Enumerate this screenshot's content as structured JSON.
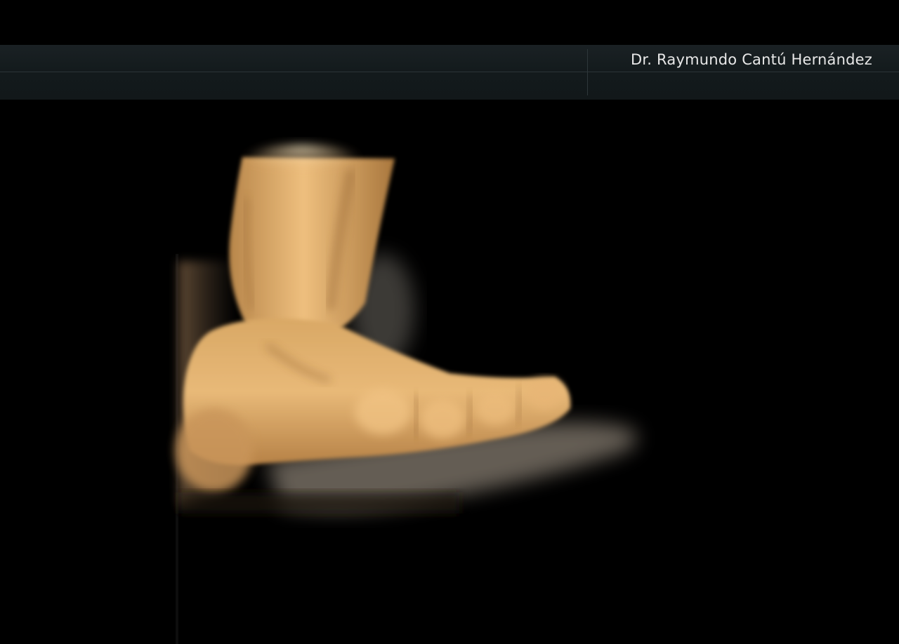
{
  "header": {
    "doctor_name": "Dr. Raymundo Cantú Hernández"
  },
  "colors": {
    "background": "#000000",
    "header_bar": "#161d1f",
    "header_text": "#e8e8e8",
    "render_tone": "#e0b070"
  },
  "viewport": {
    "image_subject": "3d-ultrasound-render"
  }
}
